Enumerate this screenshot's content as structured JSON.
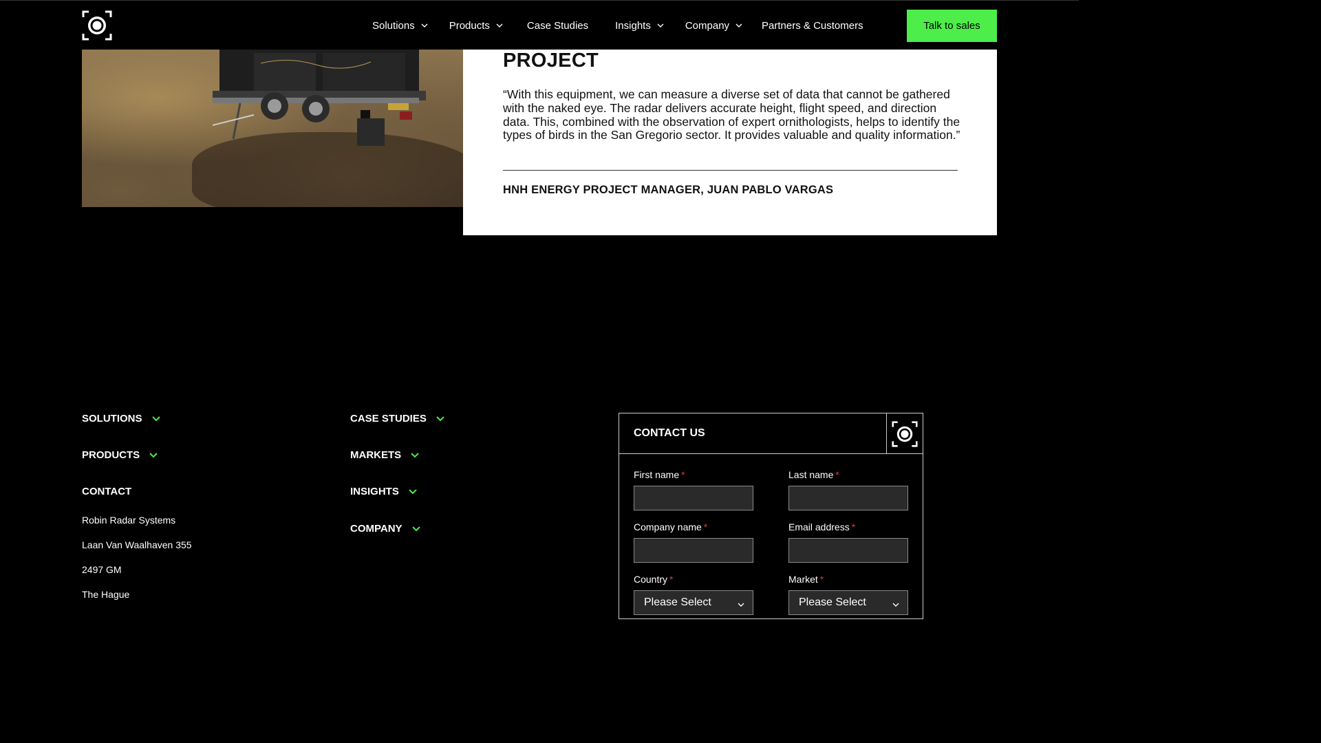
{
  "header": {
    "nav": [
      {
        "label": "Solutions",
        "dropdown": true
      },
      {
        "label": "Products",
        "dropdown": true
      },
      {
        "label": "Case Studies",
        "dropdown": false
      },
      {
        "label": "Insights",
        "dropdown": true
      },
      {
        "label": "Company",
        "dropdown": true
      },
      {
        "label": "Partners & Customers",
        "dropdown": false
      }
    ],
    "cta_label": "Talk to sales",
    "logo_icon": "radar-eye-logo-icon"
  },
  "case_study": {
    "title_visible": "PROJECT",
    "quote": "“With this equipment, we can measure a diverse set of data that cannot be gathered with the naked eye. The radar delivers accurate height, flight speed, and direction data. This, combined with the observation of expert ornithologists, helps to identify the types of birds in the San Gregorio sector. It provides valuable and quality information.”",
    "author": "HNH ENERGY PROJECT MANAGER, JUAN PABLO VARGAS"
  },
  "footer": {
    "col1": [
      {
        "label": "SOLUTIONS",
        "dropdown": true
      },
      {
        "label": "PRODUCTS",
        "dropdown": true
      },
      {
        "label": "CONTACT",
        "dropdown": false
      }
    ],
    "col2": [
      {
        "label": "CASE STUDIES",
        "dropdown": true
      },
      {
        "label": "MARKETS",
        "dropdown": true
      },
      {
        "label": "INSIGHTS",
        "dropdown": true
      },
      {
        "label": "COMPANY",
        "dropdown": true
      }
    ],
    "address": [
      "Robin Radar Systems",
      "Laan Van Waalhaven 355",
      "2497 GM",
      "The Hague"
    ]
  },
  "contact": {
    "title": "CONTACT US",
    "fields": {
      "first_name": "First name",
      "last_name": "Last name",
      "company_name": "Company name",
      "email": "Email address",
      "country": "Country",
      "market": "Market"
    },
    "required_mark": "*",
    "select_placeholder": "Please Select"
  },
  "colors": {
    "accent": "#4ded4a",
    "background": "#000000",
    "required": "#e23a3a"
  }
}
